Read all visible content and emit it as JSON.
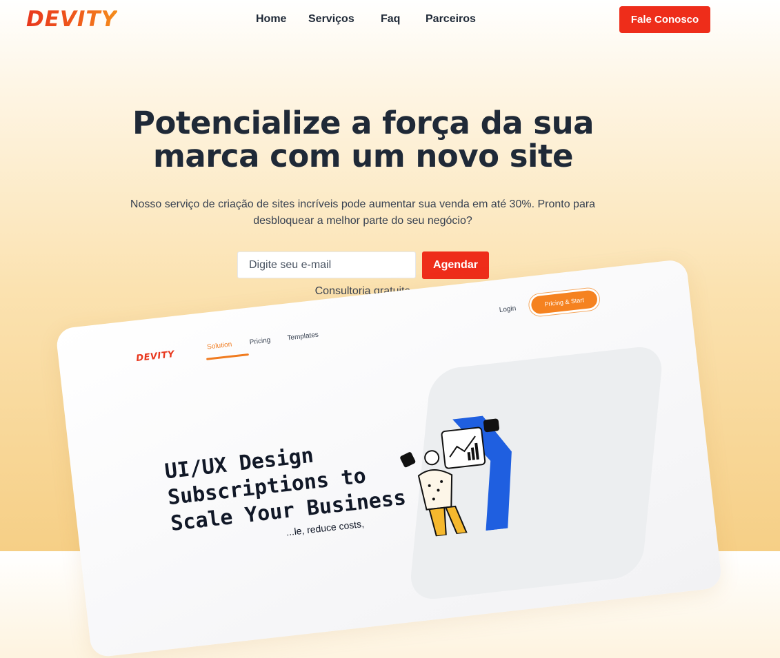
{
  "header": {
    "logo": "DEVITY",
    "nav": [
      "Home",
      "Serviços",
      "Faq",
      "Parceiros"
    ],
    "cta": "Fale Conosco"
  },
  "hero": {
    "title_line1": "Potencialize a força da sua",
    "title_line2": "marca com um novo site",
    "subtitle": "Nosso serviço de criação de sites incríveis pode aumentar sua venda em até 30%. Pronto para desbloquear a melhor parte do seu negócio?",
    "email_placeholder": "Digite seu e-mail",
    "submit_label": "Agendar",
    "note": "Consultoria gratuita"
  },
  "preview": {
    "logo": "DEVITY",
    "nav": [
      "Solution",
      "Pricing",
      "Templates"
    ],
    "login": "Login",
    "cta": "Pricing & Start",
    "headline": [
      "UI/UX Design",
      "Subscriptions to",
      "Scale Your Business"
    ],
    "body_fragment": "...le, reduce costs,"
  },
  "colors": {
    "brand_red": "#ee2d1a",
    "brand_orange": "#f58220",
    "text_dark": "#1f2937"
  }
}
